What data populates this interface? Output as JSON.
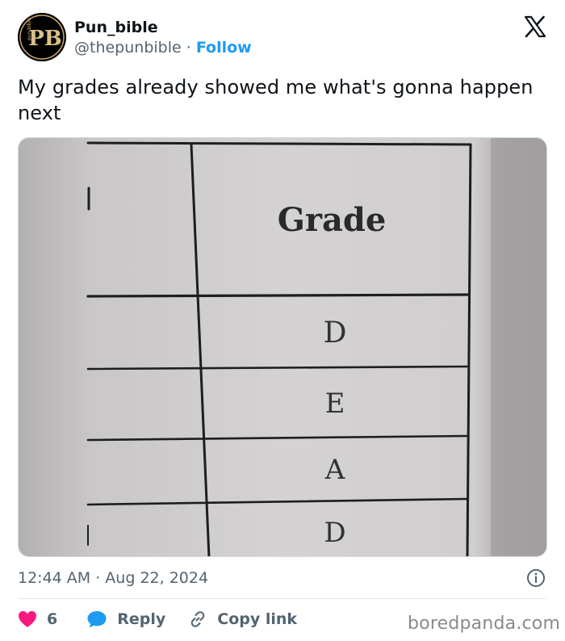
{
  "author": {
    "display_name": "Pun_bible",
    "handle": "@thepunbible",
    "separator": "·",
    "follow_label": "Follow",
    "avatar_text": "PB",
    "avatar_small_text": "pun bible"
  },
  "tweet": {
    "text": "My grades already showed me what's gonna happen next",
    "timestamp": "12:44 AM · Aug 22, 2024"
  },
  "media": {
    "header_label": "Grade",
    "grades": [
      "D",
      "E",
      "A",
      "D"
    ]
  },
  "actions": {
    "like_count": "6",
    "reply_label": "Reply",
    "copy_label": "Copy link"
  },
  "watermark": "boredpanda.com",
  "colors": {
    "accent": "#1d9bf0",
    "heart": "#f91880",
    "secondary_text": "#536471"
  },
  "icons": {
    "platform": "x-logo-icon",
    "info": "info-icon",
    "like": "heart-icon",
    "reply": "speech-bubble-icon",
    "copy": "link-icon"
  }
}
